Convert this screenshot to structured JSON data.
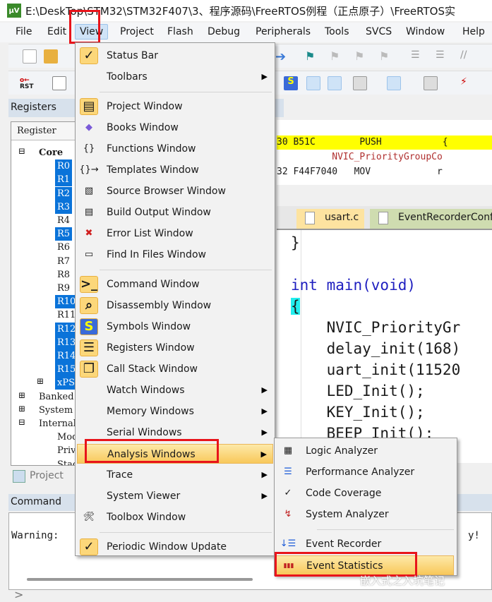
{
  "window": {
    "title": "E:\\DeskTop\\STM32\\STM32F407\\3、程序源码\\FreeRTOS例程（正点原子）\\FreeRTOS实",
    "app_icon": "uv"
  },
  "menubar": [
    "File",
    "Edit",
    "View",
    "Project",
    "Flash",
    "Debug",
    "Peripherals",
    "Tools",
    "SVCS",
    "Window",
    "Help"
  ],
  "toolbar": {
    "rst_label": "RST"
  },
  "registers": {
    "title": "Registers",
    "column": "Register",
    "items": [
      {
        "label": "Core",
        "bold": true,
        "selected": false
      },
      {
        "label": "R0",
        "selected": true
      },
      {
        "label": "R1",
        "selected": true
      },
      {
        "label": "R2",
        "selected": true
      },
      {
        "label": "R3",
        "selected": true
      },
      {
        "label": "R4",
        "selected": false
      },
      {
        "label": "R5",
        "selected": true
      },
      {
        "label": "R6",
        "selected": false
      },
      {
        "label": "R7",
        "selected": false
      },
      {
        "label": "R8",
        "selected": false
      },
      {
        "label": "R9",
        "selected": false
      },
      {
        "label": "R10",
        "selected": true
      },
      {
        "label": "R11",
        "selected": false
      },
      {
        "label": "R12",
        "selected": true
      },
      {
        "label": "R13",
        "selected": true
      },
      {
        "label": "R14",
        "selected": true
      },
      {
        "label": "R15",
        "selected": true
      },
      {
        "label": "xPSR",
        "selected": true
      },
      {
        "label": "Banked",
        "selected": false
      },
      {
        "label": "System",
        "selected": false
      },
      {
        "label": "Internal",
        "selected": false
      },
      {
        "label": "Mode",
        "selected": false
      },
      {
        "label": "Privilege",
        "selected": false
      },
      {
        "label": "Stack",
        "selected": false
      }
    ]
  },
  "disassembly": {
    "lines": [
      {
        "text": "30 B51C        PUSH           {",
        "highlight": true
      },
      {
        "text": "          NVIC_PriorityGroupCo",
        "color": "#b03030"
      },
      {
        "text": "32 F44F7040   MOV            r"
      }
    ]
  },
  "tabs": [
    {
      "label": "usart.c",
      "active": true
    },
    {
      "label": "EventRecorderConf.h"
    }
  ],
  "code": {
    "lines": [
      "}",
      "",
      "int main(void)",
      "{",
      "    NVIC_PriorityGr",
      "    delay_init(168)",
      "    uart_init(11520",
      "    LED_Init();",
      "    KEY_Init();",
      "    BEEP_Init();"
    ]
  },
  "project_tab": "Project",
  "command": {
    "title": "Command",
    "output": "Warning:",
    "output_tail": "y!",
    "prompt": ">"
  },
  "view_menu": {
    "items": [
      {
        "label": "Status Bar",
        "icon": "check-icon",
        "checked": true
      },
      {
        "label": "Toolbars",
        "submenu": true
      },
      {
        "sep": true
      },
      {
        "label": "Project Window",
        "icon": "project-window-icon",
        "checked": true
      },
      {
        "label": "Books Window",
        "icon": "books-icon"
      },
      {
        "label": "Functions Window",
        "icon": "braces-icon"
      },
      {
        "label": "Templates Window",
        "icon": "templates-icon"
      },
      {
        "label": "Source Browser Window",
        "icon": "source-browser-icon"
      },
      {
        "label": "Build Output Window",
        "icon": "build-output-icon"
      },
      {
        "label": "Error List Window",
        "icon": "error-x-icon"
      },
      {
        "label": "Find In Files Window",
        "icon": "find-in-files-icon"
      },
      {
        "sep": true
      },
      {
        "label": "Command Window",
        "icon": "command-window-icon",
        "checked": true
      },
      {
        "label": "Disassembly Window",
        "icon": "disassembly-icon",
        "checked": true
      },
      {
        "label": "Symbols Window",
        "icon": "symbols-icon",
        "checked": true
      },
      {
        "label": "Registers Window",
        "icon": "registers-icon",
        "checked": true
      },
      {
        "label": "Call Stack Window",
        "icon": "call-stack-icon",
        "checked": true
      },
      {
        "label": "Watch Windows",
        "submenu": true
      },
      {
        "label": "Memory Windows",
        "submenu": true
      },
      {
        "label": "Serial Windows",
        "submenu": true
      },
      {
        "label": "Analysis Windows",
        "submenu": true,
        "highlighted": true
      },
      {
        "label": "Trace",
        "submenu": true
      },
      {
        "label": "System Viewer",
        "submenu": true
      },
      {
        "label": "Toolbox Window",
        "icon": "toolbox-icon"
      },
      {
        "sep": true
      },
      {
        "label": "Periodic Window Update",
        "icon": "check-icon",
        "checked": true
      }
    ]
  },
  "analysis_submenu": {
    "items": [
      {
        "label": "Logic Analyzer",
        "icon": "logic-analyzer-icon"
      },
      {
        "label": "Performance Analyzer",
        "icon": "performance-analyzer-icon"
      },
      {
        "label": "Code Coverage",
        "icon": "code-coverage-icon"
      },
      {
        "label": "System Analyzer",
        "icon": "system-analyzer-icon"
      },
      {
        "sep": true
      },
      {
        "label": "Event Recorder",
        "icon": "event-recorder-icon"
      },
      {
        "label": "Event Statistics",
        "icon": "event-statistics-icon",
        "highlighted": true
      }
    ]
  },
  "watermark": "嵌入式之入坑笔记",
  "colors": {
    "highlight_box": "#e8141b",
    "selection": "#0a73d9",
    "menu_hover": "#f8c85a",
    "disasm_current": "#ffff00",
    "keyword": "#2020c0",
    "number": "#2a9a8a"
  }
}
